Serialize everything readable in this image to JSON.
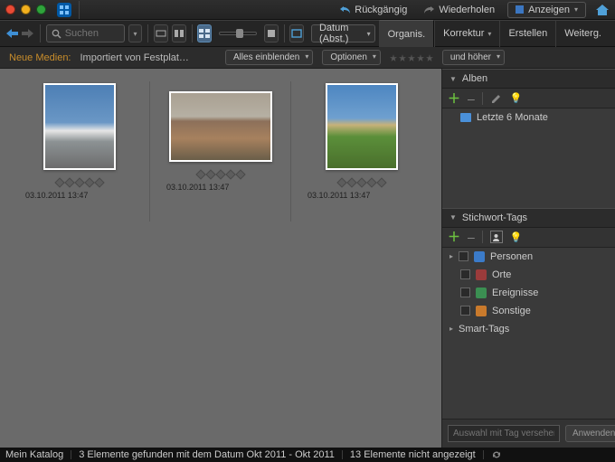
{
  "titlebar": {
    "undo": "Rückgängig",
    "redo": "Wiederholen",
    "display": "Anzeigen"
  },
  "toolbar": {
    "search_placeholder": "Suchen",
    "date_sort": "Datum (Abst.)"
  },
  "tabs": {
    "t0": "Organis.",
    "t1": "Korrektur",
    "t2": "Erstellen",
    "t3": "Weiterg."
  },
  "subbar": {
    "new_media": "Neue Medien:",
    "import_src": "Importiert von Festplat…",
    "show_all": "Alles einblenden",
    "options": "Optionen",
    "and_higher": "und höher"
  },
  "thumbs": [
    {
      "date": "03.10.2011 13:47"
    },
    {
      "date": "03.10.2011 13:47"
    },
    {
      "date": "03.10.2011 13:47"
    }
  ],
  "albums": {
    "title": "Alben",
    "item0": "Letzte 6 Monate"
  },
  "tags": {
    "title": "Stichwort-Tags",
    "persons": "Personen",
    "places": "Orte",
    "events": "Ereignisse",
    "other": "Sonstige",
    "smart": "Smart-Tags",
    "placeholder": "Auswahl mit Tag versehen",
    "apply": "Anwenden"
  },
  "status": {
    "catalog": "Mein Katalog",
    "found": "3 Elemente gefunden mit dem Datum Okt 2011 - Okt 2011",
    "hidden": "13 Elemente nicht angezeigt"
  }
}
